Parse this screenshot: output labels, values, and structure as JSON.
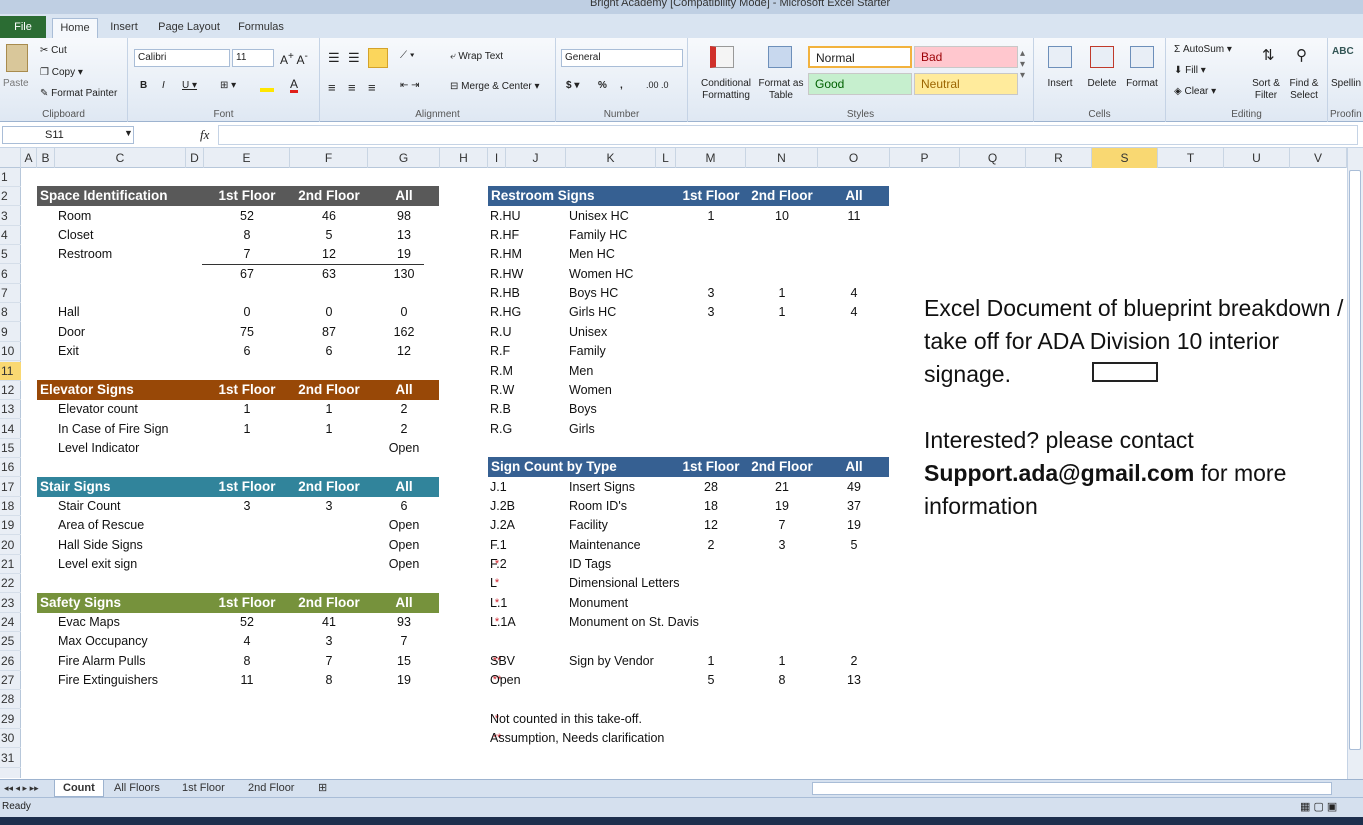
{
  "window": {
    "title": "Bright Academy  [Compatibility Mode]  -  Microsoft Excel Starter"
  },
  "ribbon": {
    "tabs": [
      {
        "label": "File"
      },
      {
        "label": "Home"
      },
      {
        "label": "Insert"
      },
      {
        "label": "Page Layout"
      },
      {
        "label": "Formulas"
      }
    ],
    "clipboard": {
      "paste": "Paste",
      "cut": "Cut",
      "copy": "Copy",
      "format_painter": "Format Painter",
      "label": "Clipboard"
    },
    "font": {
      "name": "Calibri",
      "size": "11",
      "label": "Font"
    },
    "alignment": {
      "wrap": "Wrap Text",
      "merge": "Merge & Center",
      "label": "Alignment"
    },
    "number": {
      "format": "General",
      "label": "Number",
      "currency": "$",
      "percent": "%",
      "comma": ","
    },
    "styles": {
      "conditional": "Conditional\nFormatting",
      "format_table": "Format as\nTable",
      "normal": "Normal",
      "bad": "Bad",
      "good": "Good",
      "neutral": "Neutral",
      "label": "Styles"
    },
    "cells": {
      "insert": "Insert",
      "delete": "Delete",
      "format": "Format",
      "label": "Cells"
    },
    "editing": {
      "autosum": "AutoSum",
      "fill": "Fill",
      "clear": "Clear",
      "sort": "Sort &\nFilter",
      "find": "Find &\nSelect",
      "label": "Editing"
    },
    "proofing": {
      "spelling": "Spellin",
      "label": "Proofin"
    }
  },
  "formula_bar": {
    "name_box": "S11",
    "fx": "fx",
    "value": ""
  },
  "columns": [
    "A",
    "B",
    "C",
    "D",
    "E",
    "F",
    "G",
    "H",
    "I",
    "J",
    "K",
    "L",
    "M",
    "N",
    "O",
    "P",
    "Q",
    "R",
    "S",
    "T",
    "U",
    "V"
  ],
  "rows": [
    "1",
    "2",
    "3",
    "4",
    "5",
    "6",
    "7",
    "8",
    "9",
    "10",
    "11",
    "12",
    "13",
    "14",
    "15",
    "16",
    "17",
    "18",
    "19",
    "20",
    "21",
    "22",
    "23",
    "24",
    "25",
    "26",
    "27",
    "28",
    "29",
    "30",
    "31"
  ],
  "tables": {
    "space": {
      "title": "Space Identification",
      "h1": "1st Floor",
      "h2": "2nd Floor",
      "h3": "All",
      "color": "#595959",
      "rows": [
        [
          "Room",
          "52",
          "46",
          "98"
        ],
        [
          "Closet",
          "8",
          "5",
          "13"
        ],
        [
          "Restroom",
          "7",
          "12",
          "19"
        ],
        [
          "",
          "67",
          "63",
          "130"
        ],
        [
          "",
          "",
          "",
          ""
        ],
        [
          "Hall",
          "0",
          "0",
          "0"
        ],
        [
          "Door",
          "75",
          "87",
          "162"
        ],
        [
          "Exit",
          "6",
          "6",
          "12"
        ]
      ]
    },
    "elevator": {
      "title": "Elevator Signs",
      "h1": "1st Floor",
      "h2": "2nd Floor",
      "h3": "All",
      "color": "#984807",
      "rows": [
        [
          "Elevator count",
          "1",
          "1",
          "2"
        ],
        [
          "In Case of Fire Sign",
          "1",
          "1",
          "2"
        ],
        [
          "Level Indicator",
          "",
          "",
          "Open"
        ]
      ]
    },
    "stair": {
      "title": "Stair Signs",
      "h1": "1st Floor",
      "h2": "2nd Floor",
      "h3": "All",
      "color": "#31849b",
      "rows": [
        [
          "Stair Count",
          "3",
          "3",
          "6"
        ],
        [
          "Area of Rescue",
          "",
          "",
          "Open"
        ],
        [
          "Hall Side Signs",
          "",
          "",
          "Open"
        ],
        [
          "Level exit sign",
          "",
          "",
          "Open"
        ]
      ]
    },
    "safety": {
      "title": "Safety Signs",
      "h1": "1st Floor",
      "h2": "2nd Floor",
      "h3": "All",
      "color": "#76923c",
      "rows": [
        [
          "Evac Maps",
          "52",
          "41",
          "93"
        ],
        [
          "Max Occupancy",
          "4",
          "3",
          "7"
        ],
        [
          "Fire Alarm Pulls",
          "8",
          "7",
          "15"
        ],
        [
          "Fire Extinguishers",
          "11",
          "8",
          "19"
        ]
      ]
    },
    "restroom": {
      "title": "Restroom Signs",
      "h1": "1st Floor",
      "h2": "2nd Floor",
      "h3": "All",
      "color": "#366092",
      "rows": [
        [
          "R.HU",
          "Unisex HC",
          "1",
          "10",
          "11"
        ],
        [
          "R.HF",
          "Family HC",
          "",
          "",
          ""
        ],
        [
          "R.HM",
          "Men HC",
          "",
          "",
          ""
        ],
        [
          "R.HW",
          "Women HC",
          "",
          "",
          ""
        ],
        [
          "R.HB",
          "Boys HC",
          "3",
          "1",
          "4"
        ],
        [
          "R.HG",
          "Girls HC",
          "3",
          "1",
          "4"
        ],
        [
          "R.U",
          "Unisex",
          "",
          "",
          ""
        ],
        [
          "R.F",
          "Family",
          "",
          "",
          ""
        ],
        [
          "R.M",
          "Men",
          "",
          "",
          ""
        ],
        [
          "R.W",
          "Women",
          "",
          "",
          ""
        ],
        [
          "R.B",
          "Boys",
          "",
          "",
          ""
        ],
        [
          "R.G",
          "Girls",
          "",
          "",
          ""
        ]
      ]
    },
    "signcount": {
      "title": "Sign Count by Type",
      "h1": "1st Floor",
      "h2": "2nd Floor",
      "h3": "All",
      "color": "#366092",
      "rows": [
        [
          "",
          "J.1",
          "Insert Signs",
          "28",
          "21",
          "49"
        ],
        [
          "",
          "J.2B",
          "Room ID's",
          "18",
          "19",
          "37"
        ],
        [
          "",
          "J.2A",
          "Facility",
          "12",
          "7",
          "19"
        ],
        [
          "",
          "F.1",
          "Maintenance",
          "2",
          "3",
          "5"
        ],
        [
          "*",
          "F.2",
          "ID Tags",
          "",
          "",
          ""
        ],
        [
          "*",
          "L",
          "Dimensional Letters",
          "",
          "",
          ""
        ],
        [
          "*",
          "L.1",
          "Monument",
          "",
          "",
          ""
        ],
        [
          "*",
          "L.1A",
          "Monument on St. Davis",
          "",
          "",
          ""
        ],
        [
          "",
          "",
          "",
          "",
          "",
          ""
        ],
        [
          "**",
          "SBV",
          "Sign by Vendor",
          "1",
          "1",
          "2"
        ],
        [
          "**",
          "Open",
          "",
          "5",
          "8",
          "13"
        ]
      ]
    },
    "footnotes": [
      [
        "*",
        "Not counted in this take-off."
      ],
      [
        "**",
        "Assumption, Needs clarification"
      ]
    ]
  },
  "note": {
    "line1": "Excel Document of blueprint breakdown / take off for ADA Division 10 interior signage.",
    "line2a": "Interested?  please contact",
    "email": "Support.ada@gmail.com",
    "line2b": " for more information"
  },
  "sheet_tabs": [
    {
      "label": "Count"
    },
    {
      "label": "All Floors"
    },
    {
      "label": "1st Floor"
    },
    {
      "label": "2nd Floor"
    }
  ],
  "status": {
    "ready": "Ready"
  }
}
